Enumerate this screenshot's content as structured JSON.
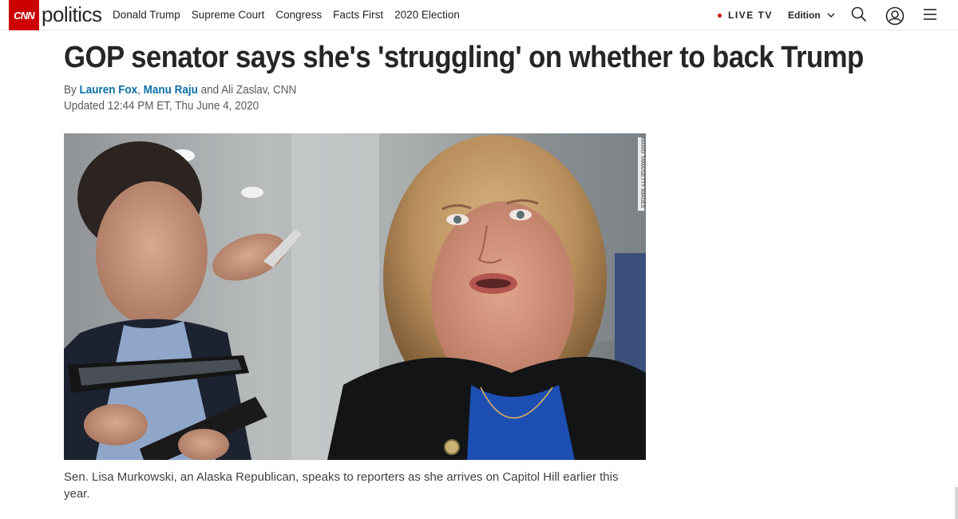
{
  "nav": {
    "logo": "CNN",
    "section": "politics",
    "links": [
      "Donald Trump",
      "Supreme Court",
      "Congress",
      "Facts First",
      "2020 Election"
    ],
    "live_tv": "LIVE TV",
    "edition": "Edition",
    "accent_color": "#cc0000",
    "icons": [
      "search-icon",
      "user-icon",
      "menu-icon",
      "chevron-down-icon"
    ]
  },
  "article": {
    "headline": "GOP senator says she's 'struggling' on whether to back Trump",
    "byline": {
      "prefix": "By",
      "author1": "Lauren Fox",
      "sep1": ",",
      "author2": "Manu Raju",
      "suffix": "and Ali Zaslav, CNN"
    },
    "updated": "Updated 12:44 PM ET, Thu June 4, 2020",
    "photo_credit": "MARIO TAMA/GETTY IMAGES",
    "caption": "Sen. Lisa Murkowski, an Alaska Republican, speaks to reporters as she arrives on Capitol Hill earlier this year.",
    "link_color": "#0c6ea6"
  }
}
